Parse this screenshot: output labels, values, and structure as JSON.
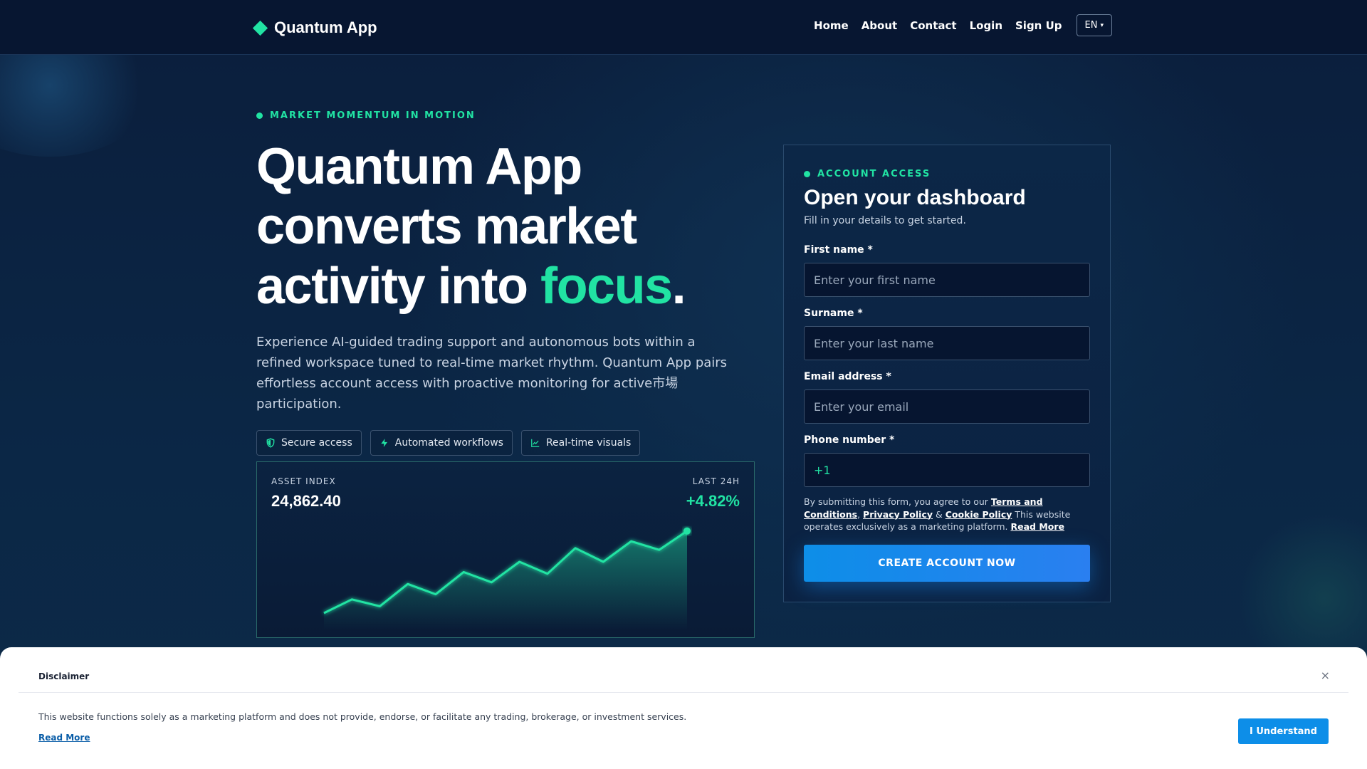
{
  "header": {
    "brand": "Quantum App",
    "nav": [
      "Home",
      "About",
      "Contact",
      "Login",
      "Sign Up"
    ],
    "language": "EN"
  },
  "hero": {
    "eyebrow": "MARKET MOMENTUM IN MOTION",
    "title_line1": "Quantum App",
    "title_line2": "converts market",
    "title_line3_prefix": "activity into ",
    "title_accent": "focus",
    "title_suffix": ".",
    "description": "Experience AI-guided trading support and autonomous bots within a refined workspace tuned to real-time market rhythm. Quantum App pairs effortless account access with proactive monitoring for active市場 participation.",
    "chips": [
      {
        "label": "Secure access",
        "icon": "shield-icon"
      },
      {
        "label": "Automated workflows",
        "icon": "bolt-icon"
      },
      {
        "label": "Real-time visuals",
        "icon": "line-chart-icon"
      }
    ]
  },
  "index_card": {
    "label": "ASSET INDEX",
    "value": "24,862.40",
    "period_label": "LAST 24H",
    "change": "+4.82%"
  },
  "chart_data": {
    "type": "area",
    "values": [
      0,
      8,
      4,
      17,
      11,
      24,
      18,
      30,
      23,
      38,
      30,
      42,
      37,
      48
    ],
    "ylim": [
      0,
      50
    ],
    "grid": false,
    "color": "#21e3a3"
  },
  "form": {
    "eyebrow": "ACCOUNT ACCESS",
    "title": "Open your dashboard",
    "subtitle": "Fill in your details to get started.",
    "first_name_label": "First name *",
    "first_name_placeholder": "Enter your first name",
    "surname_label": "Surname *",
    "surname_placeholder": "Enter your last name",
    "email_label": "Email address *",
    "email_placeholder": "Enter your email",
    "phone_label": "Phone number *",
    "phone_code": "+1",
    "consent_prefix": "By submitting this form, you agree to our ",
    "terms_link": "Terms and Conditions",
    "comma": ", ",
    "privacy_link": "Privacy Policy",
    "amp": " & ",
    "cookie_link": "Cookie Policy",
    "consent_suffix": " This website operates exclusively as a marketing platform. ",
    "read_more": "Read More",
    "submit_label": "CREATE ACCOUNT NOW"
  },
  "disclaimer": {
    "title": "Disclaimer",
    "close": "×",
    "text": "This website functions solely as a marketing platform and does not provide, endorse, or facilitate any trading, brokerage, or investment services.",
    "read_more": "Read More",
    "button": "I Understand"
  },
  "colors": {
    "accent": "#21e3a3",
    "primary_button": "#0d8ee8",
    "background": "#0a1f3d"
  }
}
